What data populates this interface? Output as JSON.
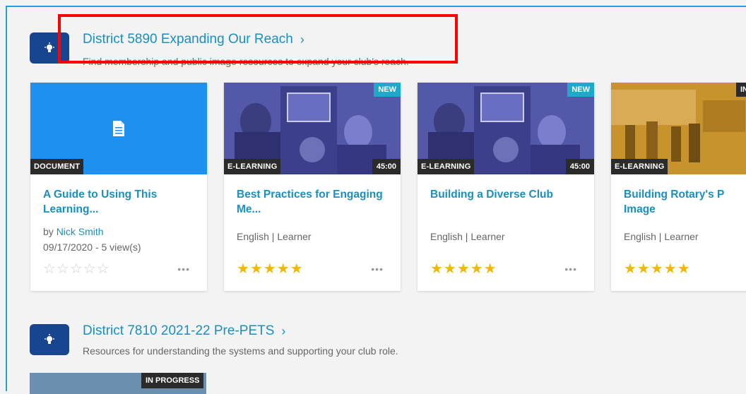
{
  "sections": [
    {
      "title": "District 5890 Expanding Our Reach",
      "subtitle": "Find membership and public image resources to expand your club's reach."
    },
    {
      "title": "District 7810 2021-22 Pre-PETS",
      "subtitle": "Resources for understanding the systems and supporting your club role."
    }
  ],
  "chevron": "›",
  "cards": [
    {
      "type": "DOCUMENT",
      "title": "A Guide to Using This Learning...",
      "author_prefix": "by",
      "author": "Nick Smith",
      "date_views": "09/17/2020 - 5 view(s)",
      "stars": "☆☆☆☆☆",
      "more": "•••"
    },
    {
      "type": "E-LEARNING",
      "badge": "NEW",
      "duration": "45:00",
      "title": "Best Practices for Engaging Me...",
      "meta": "English | Learner",
      "stars": "★★★★★",
      "more": "•••"
    },
    {
      "type": "E-LEARNING",
      "badge": "NEW",
      "duration": "45:00",
      "title": "Building a Diverse Club",
      "meta": "English | Learner",
      "stars": "★★★★★",
      "more": "•••"
    },
    {
      "type": "E-LEARNING",
      "badge": "IN",
      "title": "Building Rotary's P Image",
      "meta": "English | Learner",
      "stars": "★★★★★"
    }
  ],
  "in_progress_badge": "IN PROGRESS",
  "rating_filled": 5,
  "colors": {
    "brand_blue": "#17458f",
    "link_blue": "#1a8fbe",
    "doc_blue": "#1e90f0",
    "star_gold": "#f2b705",
    "highlight_red": "#ff0000"
  },
  "icons": {
    "section_icon": "lightbulb-icon",
    "doc_icon": "document-icon"
  }
}
